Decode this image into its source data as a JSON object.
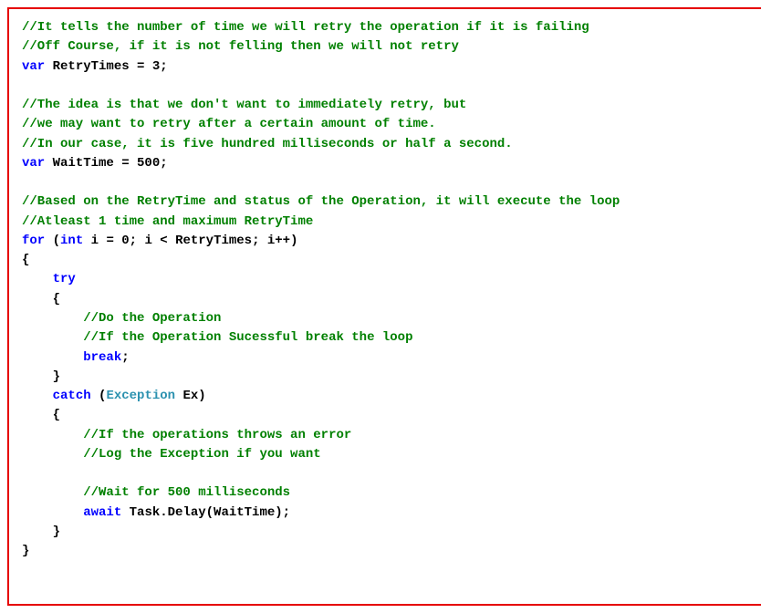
{
  "code": {
    "lines": [
      [
        {
          "c": "cm",
          "t": "//It tells the number of time we will retry the operation if it is failing"
        }
      ],
      [
        {
          "c": "cm",
          "t": "//Off Course, if it is not felling then we will not retry"
        }
      ],
      [
        {
          "c": "kw",
          "t": "var"
        },
        {
          "c": "",
          "t": " RetryTimes = 3;"
        }
      ],
      [
        {
          "c": "",
          "t": ""
        }
      ],
      [
        {
          "c": "cm",
          "t": "//The idea is that we don't want to immediately retry, but"
        }
      ],
      [
        {
          "c": "cm",
          "t": "//we may want to retry after a certain amount of time."
        }
      ],
      [
        {
          "c": "cm",
          "t": "//In our case, it is five hundred milliseconds or half a second."
        }
      ],
      [
        {
          "c": "kw",
          "t": "var"
        },
        {
          "c": "",
          "t": " WaitTime = 500;"
        }
      ],
      [
        {
          "c": "",
          "t": ""
        }
      ],
      [
        {
          "c": "cm",
          "t": "//Based on the RetryTime and status of the Operation, it will execute the loop"
        }
      ],
      [
        {
          "c": "cm",
          "t": "//Atleast 1 time and maximum RetryTime"
        }
      ],
      [
        {
          "c": "kw",
          "t": "for"
        },
        {
          "c": "",
          "t": " ("
        },
        {
          "c": "kw",
          "t": "int"
        },
        {
          "c": "",
          "t": " i = 0; i < RetryTimes; i++)"
        }
      ],
      [
        {
          "c": "",
          "t": "{"
        }
      ],
      [
        {
          "c": "",
          "t": "    "
        },
        {
          "c": "kw",
          "t": "try"
        }
      ],
      [
        {
          "c": "",
          "t": "    {"
        }
      ],
      [
        {
          "c": "",
          "t": "        "
        },
        {
          "c": "cm",
          "t": "//Do the Operation"
        }
      ],
      [
        {
          "c": "",
          "t": "        "
        },
        {
          "c": "cm",
          "t": "//If the Operation Sucessful break the loop"
        }
      ],
      [
        {
          "c": "",
          "t": "        "
        },
        {
          "c": "kw",
          "t": "break"
        },
        {
          "c": "",
          "t": ";"
        }
      ],
      [
        {
          "c": "",
          "t": "    }"
        }
      ],
      [
        {
          "c": "",
          "t": "    "
        },
        {
          "c": "kw",
          "t": "catch"
        },
        {
          "c": "",
          "t": " ("
        },
        {
          "c": "tn",
          "t": "Exception"
        },
        {
          "c": "",
          "t": " Ex)"
        }
      ],
      [
        {
          "c": "",
          "t": "    {"
        }
      ],
      [
        {
          "c": "",
          "t": "        "
        },
        {
          "c": "cm",
          "t": "//If the operations throws an error"
        }
      ],
      [
        {
          "c": "",
          "t": "        "
        },
        {
          "c": "cm",
          "t": "//Log the Exception if you want"
        }
      ],
      [
        {
          "c": "",
          "t": ""
        }
      ],
      [
        {
          "c": "",
          "t": "        "
        },
        {
          "c": "cm",
          "t": "//Wait for 500 milliseconds"
        }
      ],
      [
        {
          "c": "",
          "t": "        "
        },
        {
          "c": "kw",
          "t": "await"
        },
        {
          "c": "",
          "t": " Task.Delay(WaitTime);"
        }
      ],
      [
        {
          "c": "",
          "t": "    }"
        }
      ],
      [
        {
          "c": "",
          "t": "}"
        }
      ]
    ]
  }
}
